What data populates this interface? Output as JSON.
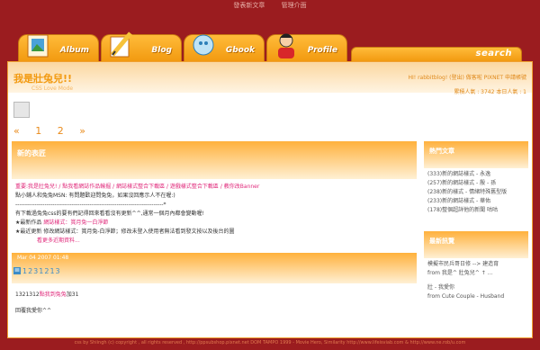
{
  "topnav": [
    "發表新文章",
    "管理介面"
  ],
  "tabs": [
    {
      "label": "Album",
      "icon": "album-icon"
    },
    {
      "label": "Blog",
      "icon": "blog-pencil-icon"
    },
    {
      "label": "Gbook",
      "icon": "gbook-icon"
    },
    {
      "label": "Profile",
      "icon": "profile-icon"
    }
  ],
  "search_label": "search",
  "header": {
    "title": "我是壯兔兒!!",
    "subtitle": "CSS Love Mode",
    "hi": "HI! rabbitblog! (登出) 做客啦 PIXNET 申請帳號",
    "hits": "累積人氣 : 3742   本日人氣 : 1"
  },
  "pager": {
    "prev": "«",
    "pages": [
      "1",
      "2"
    ],
    "next": "»"
  },
  "post1": {
    "title": "新的表匠",
    "links_line": "重要:我是壯兔兒! / 點我看網誌作品輸掘 / 網誌樣式整合下載區 / 遊戲樣式整合下載區 / 教你改Banner",
    "msn_line": "點小鋪人和兔兔MSN: 有問題歡迎問兔兔，如果沒回應示人不在喔:)",
    "dash": "----------------------------------------------------------------------------*",
    "update_line": "有下載過兔兔css的要有們記得回來看看沒有更新^^,通常一個月內都會變動喔!",
    "new_label": "★最新作品",
    "new_link": "網誌樣式：賞月兔一白淨節",
    "upd_label": "★最近更新",
    "upd_text": "修改網誌樣式：賞月兔-白淨節；修改未登入使用者無法看到發文按以及後台的圖",
    "more_link": "看更多近期資料..."
  },
  "post2": {
    "date": "Mar 04 2007 01:48",
    "title": "1231213",
    "body_prefix": "1321312",
    "body_link": "點我到兔兔",
    "body_suffix": "加31",
    "reply": "回覆我愛你^^"
  },
  "side": {
    "hot_title": "熱門文章",
    "hot": [
      "(333)新的網誌樣式 - 永逸",
      "(257)新的網誌樣式 - 殷 - 孫",
      "(238)新的樣式 - 情緒特殊舊型版",
      "(233)新的網誌樣式 - 華佑",
      "(178)整個超詳他的新聞 咕咕"
    ],
    "new_title": "最新訊覽",
    "new_items": [
      "模擬市民兵哥日修 --> 建造育",
      "from 我是^ 壯兔兒^ ↑ ...",
      "",
      "壯 - 我愛你",
      "from Cute Couple - Husband"
    ]
  },
  "footer": "css by Shiingh (c) copyright , all rights reserved , http://ppsubshop.pixnet.net     DOM TAMPO 1999 - Movie Hero, Similarity http://www.lifeisviab.com & http://www.ne.rob/u.com"
}
